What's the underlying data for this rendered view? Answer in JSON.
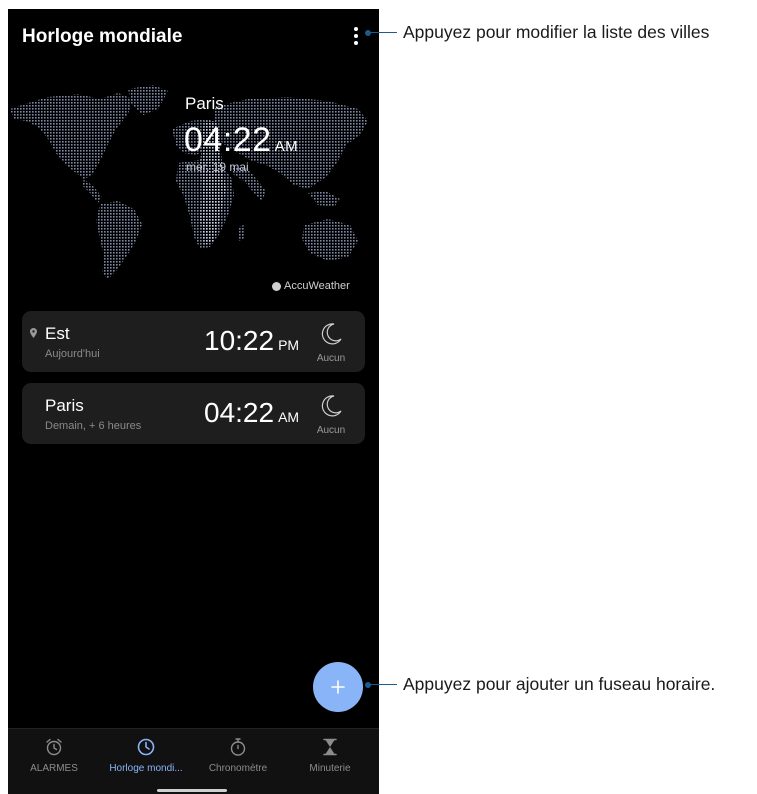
{
  "app": {
    "title": "Horloge mondiale",
    "accent_color": "#8ab4f8",
    "background_color": "#000000"
  },
  "hero": {
    "city": "Paris",
    "time": "04:22",
    "ampm": "AM",
    "date": "mer. 19 mai",
    "attribution": "AccuWeather"
  },
  "clocks": [
    {
      "city": "Est",
      "subtitle": "Aujourd'hui",
      "time": "10:22",
      "ampm": "PM",
      "weather": "Aucun",
      "icon": "moon-icon",
      "is_current_location": true
    },
    {
      "city": "Paris",
      "subtitle": "Demain, + 6 heures",
      "time": "04:22",
      "ampm": "AM",
      "weather": "Aucun",
      "icon": "moon-icon",
      "is_current_location": false
    }
  ],
  "fab": {
    "icon": "plus-icon"
  },
  "bottom_nav": [
    {
      "label": "ALARMES",
      "icon": "alarm-icon",
      "active": false
    },
    {
      "label": "Horloge mondi...",
      "icon": "clock-icon",
      "active": true
    },
    {
      "label": "Chronomètre",
      "icon": "stopwatch-icon",
      "active": false
    },
    {
      "label": "Minuterie",
      "icon": "hourglass-icon",
      "active": false
    }
  ],
  "annotations": {
    "menu": "Appuyez pour modifier la liste des villes",
    "fab": "Appuyez pour ajouter un fuseau horaire."
  }
}
